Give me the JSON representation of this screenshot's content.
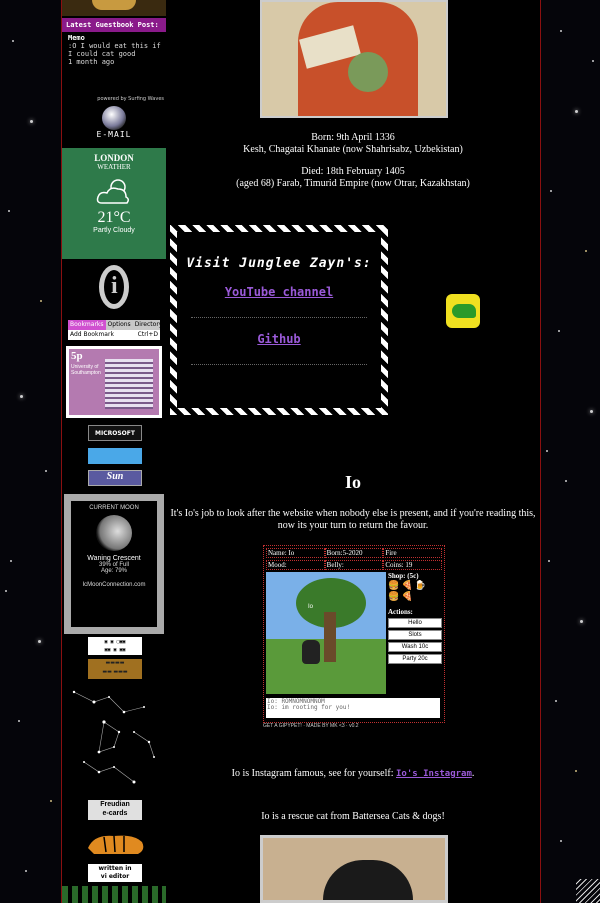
{
  "guestbook": {
    "header": "Latest Guestbook Post:",
    "author": "Memo",
    "message": ":O I would eat this if I could cat good",
    "when": "1 month ago",
    "powered": "powered by Surfing Waves"
  },
  "email": {
    "label": "E-MAIL"
  },
  "weather": {
    "city": "LONDON",
    "label": "WEATHER",
    "temp": "21°C",
    "condition": "Partly Cloudy"
  },
  "menubar": {
    "items": [
      "Bookmarks",
      "Options",
      "Directory"
    ],
    "add": "Add Bookmark",
    "shortcut": "Ctrl+D"
  },
  "stamp": {
    "value": "5p",
    "text": "University of Southampton"
  },
  "badges": {
    "microsoft": "MICROSOFT",
    "sun": "Sun"
  },
  "moon": {
    "title": "CURRENT MOON",
    "phase": "Waning Crescent",
    "full": "39% of Full",
    "age": "Age: 79%",
    "site": "IcMoonConnection.com"
  },
  "freudian": {
    "line1": "Freudian",
    "line2": "e-cards"
  },
  "vi": {
    "line1": "written in",
    "line2": "vi editor"
  },
  "bio": {
    "born": "Born: 9th April 1336",
    "born_place": "Kesh, Chagatai Khanate (now Shahrisabz, Uzbekistan)",
    "died": "Died: 18th February 1405",
    "died_place": "(aged 68) Farab, Timurid Empire (now Otrar, Kazakhstan)"
  },
  "visit": {
    "title": "Visit Junglee Zayn's:",
    "youtube": "YouTube channel",
    "github": "Github"
  },
  "io": {
    "heading": "Io",
    "intro": "It's Io's job to look after the website when nobody else is present, and if you're reading this, now its your turn to return the favour.",
    "insta_text": "Io is Instagram famous, see for yourself:",
    "insta_link": "Io's Instagram",
    "insta_end": ".",
    "rescue": "Io is a rescue cat from Battersea Cats & dogs!"
  },
  "pet": {
    "name": "Name: Io",
    "born": "Born:5-2020",
    "element": "Fire",
    "mood": "Mood:",
    "belly": "Belly:",
    "coins": "Coins: 19",
    "scene_label": "Io",
    "shop": "Shop: (5c)",
    "actions": "Actions:",
    "buttons": [
      "Hello",
      "Slots",
      "Wash 10c",
      "Party 20c"
    ],
    "log1": "Io: ROMNOMNOMNOM",
    "log2": "Io: im rooting for you!",
    "footer": "GET A GIPYPET! · MADE BY MK <3 · v0.2"
  }
}
